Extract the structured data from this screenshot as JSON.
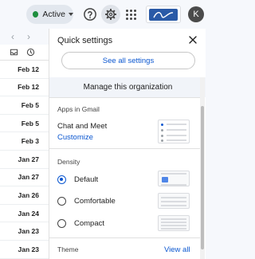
{
  "header": {
    "status_label": "Active",
    "avatar_initial": "K"
  },
  "mail_list": {
    "dates": [
      "Feb 12",
      "Feb 12",
      "Feb 5",
      "Feb 5",
      "Feb 3",
      "Jan 27",
      "Jan 27",
      "Jan 26",
      "Jan 24",
      "Jan 23",
      "Jan 23"
    ]
  },
  "quick_settings": {
    "title": "Quick settings",
    "see_all_label": "See all settings",
    "manage_label": "Manage this organization",
    "apps_section_label": "Apps in Gmail",
    "chat_meet_label": "Chat and Meet",
    "customize_label": "Customize",
    "density_section_label": "Density",
    "density_options": [
      {
        "label": "Default",
        "selected": true
      },
      {
        "label": "Comfortable",
        "selected": false
      },
      {
        "label": "Compact",
        "selected": false
      }
    ],
    "theme_label": "Theme",
    "view_all_label": "View all"
  },
  "colors": {
    "accent_blue": "#0b57d0",
    "status_green": "#1e8e3e"
  },
  "icons": [
    "chevron-left-icon",
    "chevron-right-icon",
    "inbox-icon",
    "clock-icon",
    "help-icon",
    "gear-icon",
    "apps-grid-icon",
    "close-icon"
  ]
}
